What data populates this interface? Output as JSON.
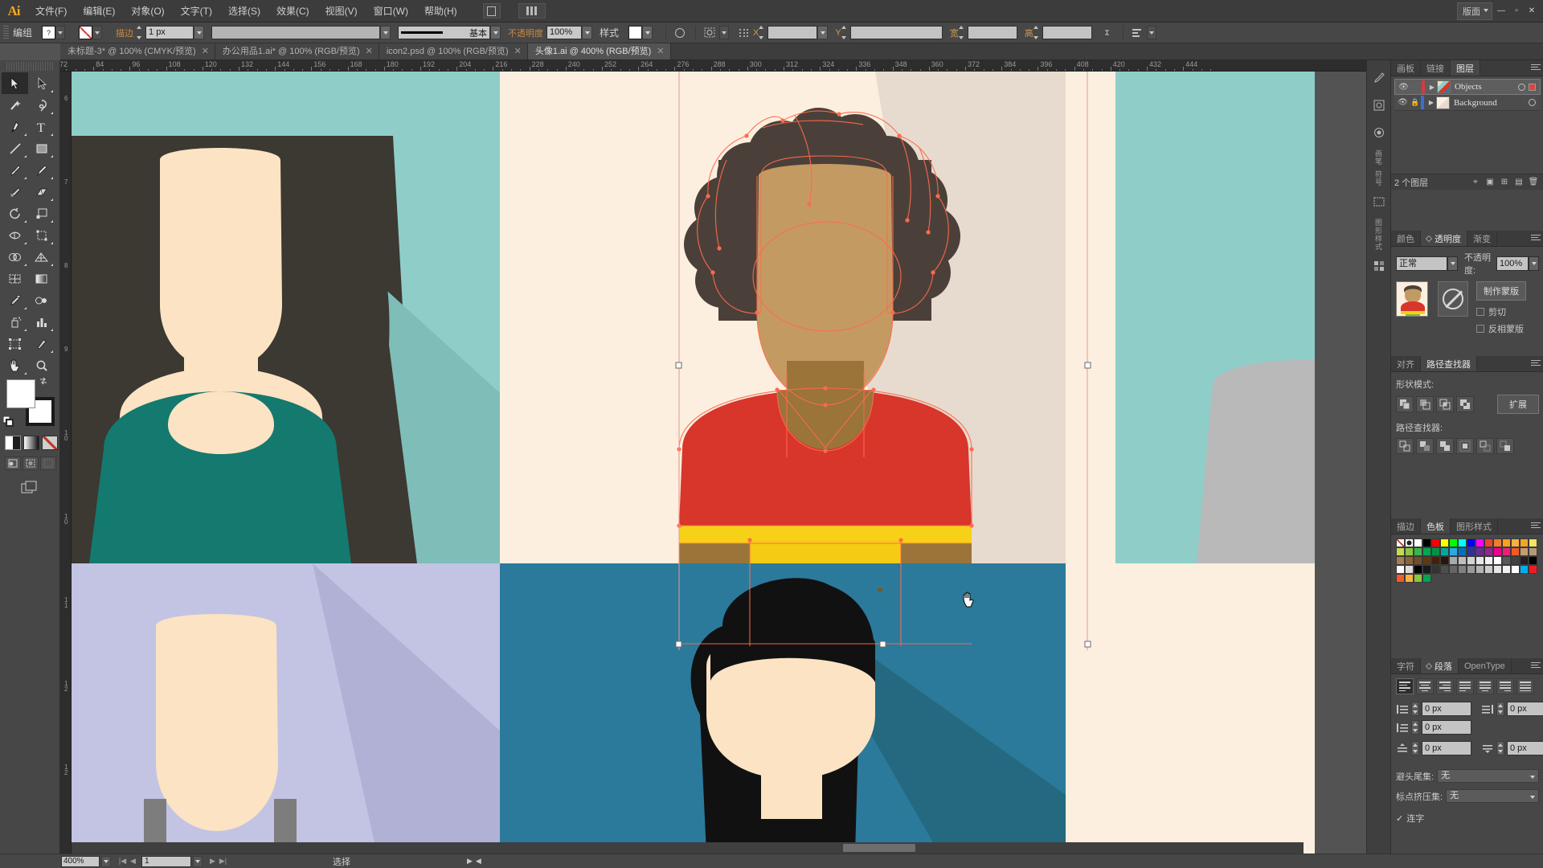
{
  "app": {
    "name": "Ai",
    "workspace_label": "版面"
  },
  "menu": {
    "items": [
      "文件(F)",
      "编辑(E)",
      "对象(O)",
      "文字(T)",
      "选择(S)",
      "效果(C)",
      "视图(V)",
      "窗口(W)",
      "帮助(H)"
    ]
  },
  "control_bar": {
    "selection_label": "编组",
    "fill_value": "?",
    "stroke_none": "none-swatch",
    "stroke_label": "描边",
    "stroke_weight": "1 px",
    "profile_value": "",
    "brush_label": "基本",
    "opacity_label": "不透明度",
    "opacity_value": "100%",
    "style_label": "样式",
    "transform_x": "",
    "transform_y": "",
    "width_label": "宽",
    "width_value": "",
    "height_label": "高",
    "height_value": "",
    "angle_value": ""
  },
  "tabs": [
    {
      "label": "未标题-3* @ 100% (CMYK/预览)",
      "active": false
    },
    {
      "label": "办公用品1.ai* @ 100% (RGB/预览)",
      "active": false
    },
    {
      "label": "icon2.psd @ 100% (RGB/预览)",
      "active": false
    },
    {
      "label": "头像1.ai @ 400% (RGB/预览)",
      "active": true
    }
  ],
  "rulers": {
    "horizontal_ticks": [
      "72",
      "84",
      "96",
      "108",
      "120",
      "132",
      "144",
      "156",
      "168",
      "180",
      "192",
      "204",
      "216",
      "228",
      "240",
      "252",
      "264",
      "276",
      "288",
      "300",
      "312",
      "324",
      "336",
      "348",
      "360",
      "372",
      "384",
      "396",
      "408",
      "420",
      "432",
      "444"
    ],
    "vertical_ticks": [
      "6",
      "7",
      "8",
      "9",
      "10",
      "10",
      "11",
      "12",
      "12"
    ],
    "unit": "px"
  },
  "toolbar": {
    "tools": [
      "selection-tool",
      "direct-selection-tool",
      "magic-wand-tool",
      "lasso-tool",
      "pen-tool",
      "type-tool",
      "line-segment-tool",
      "rectangle-tool",
      "paintbrush-tool",
      "pencil-tool",
      "blob-brush-tool",
      "eraser-tool",
      "rotate-tool",
      "scale-tool",
      "width-tool",
      "free-transform-tool",
      "shape-builder-tool",
      "perspective-grid-tool",
      "mesh-tool",
      "gradient-tool",
      "eyedropper-tool",
      "blend-tool",
      "symbol-sprayer-tool",
      "column-graph-tool",
      "artboard-tool",
      "slice-tool",
      "hand-tool",
      "zoom-tool"
    ],
    "fill_color": "#ffffff",
    "stroke_color": "#ffffff",
    "modes": [
      "color-mode",
      "gradient-mode",
      "none-mode"
    ],
    "screen_modes": [
      "normal-screen-mode",
      "full-screen-menu-mode",
      "full-screen-mode"
    ]
  },
  "dock": {
    "rail_labels": [
      "画笔",
      "符号",
      "图形样式",
      "画板",
      "色板"
    ],
    "layers_panel": {
      "tabs": [
        "画板",
        "链接",
        "图层"
      ],
      "active_tab": "图层",
      "rows": [
        {
          "name": "Objects",
          "visible": true,
          "locked": false,
          "selected": true,
          "color": "#cf3e3e"
        },
        {
          "name": "Background",
          "visible": true,
          "locked": true,
          "selected": false,
          "color": "#3e6fcf"
        }
      ],
      "footer_count": "2 个图层"
    },
    "transparency_panel": {
      "tabs": [
        "颜色",
        "透明度",
        "渐变"
      ],
      "active_tab": "透明度",
      "blend_mode": "正常",
      "opacity_label": "不透明度:",
      "opacity_value": "100%",
      "make_mask_button": "制作蒙版",
      "clip_label": "剪切",
      "invert_mask_label": "反相蒙版"
    },
    "pathfinder_panel": {
      "tabs": [
        "对齐",
        "路径查找器"
      ],
      "active_tab": "路径查找器",
      "shape_modes_label": "形状模式:",
      "expand_button": "扩展",
      "pathfinders_label": "路径查找器:"
    },
    "swatches_panel": {
      "tabs": [
        "描边",
        "色板",
        "图形样式"
      ],
      "active_tab": "色板",
      "row1": [
        "#ffffff",
        "#000000",
        "#ff0000",
        "#ffff00",
        "#00ff00",
        "#00ffff",
        "#0000ff",
        "#ff00ff",
        "#e8452c",
        "#ef7d2e",
        "#f9a01b",
        "#fbb040"
      ],
      "row2": [
        "#f5a623",
        "#f7e463",
        "#c7d94d",
        "#8dc63f",
        "#39b54a",
        "#00a651",
        "#009245",
        "#00a99d",
        "#29abe2",
        "#0071bc",
        "#2e3192",
        "#662d91"
      ],
      "row3": [
        "#92278f",
        "#ec008c",
        "#ed1e79",
        "#f15a24",
        "#c69c6d",
        "#b3987a",
        "#a67c52",
        "#8c6239",
        "#754c24",
        "#603813",
        "#42210b",
        "#2b1508"
      ],
      "row4": [
        "#a7a9ac",
        "#bcbec0",
        "#d1d3d4",
        "#e6e7e8",
        "#f1f2f2",
        "#ffffff",
        "#58595b",
        "#414042",
        "#231f20",
        "#000000",
        "#ffffff",
        "#dcdcdc"
      ],
      "row5": [
        "#000000",
        "#1a1a1a",
        "#333333",
        "#4d4d4d",
        "#666666",
        "#808080",
        "#999999",
        "#b3b3b3",
        "#cccccc",
        "#e6e6e6",
        "#f2f2f2",
        "#ffffff"
      ],
      "row6": [
        "#00aeef",
        "#ec1c24",
        "#f15a29",
        "#fbb040",
        "#8dc63f",
        "#00a651"
      ]
    },
    "paragraph_panel": {
      "tabs": [
        "字符",
        "段落",
        "OpenType"
      ],
      "active_tab": "段落",
      "indent_left": "0 px",
      "indent_right": "0 px",
      "indent_first": "0 px",
      "space_before": "0 px",
      "space_after": "0 px",
      "hanging_label": "避头尾集:",
      "hanging_value": "无",
      "burasagari_label": "标点挤压集:",
      "burasagari_value": "无",
      "hyphenate_label": "连字",
      "hyphenate_checked": true,
      "unit": "px"
    }
  },
  "status_bar": {
    "zoom": "400%",
    "page": "1",
    "status_text": "选择"
  },
  "artwork": {
    "canvas_zoom": "400%",
    "description": "flat-illustration-avatar-grid",
    "cells": [
      {
        "name": "avatar-woman-teal",
        "bg": "#8fcdc8",
        "skin": "#fbe3c3",
        "hair": "#3f3a35",
        "shirt": "#14796e"
      },
      {
        "name": "avatar-selected-afro",
        "bg": "#fcefdf",
        "skin": "#c49a63",
        "hair": "#4b4039",
        "shirt": "#d8352b",
        "stripe_yellow": "#f7d117",
        "stripe_green": "#7dbb2f",
        "arm": "#9a7439"
      },
      {
        "name": "avatar-right-teal",
        "bg": "#8fcdc8",
        "skin": "#bfbfbf"
      },
      {
        "name": "avatar-lavender",
        "bg": "#c3c3e4",
        "skin": "#fbe3c3"
      },
      {
        "name": "avatar-blue-pigtails",
        "bg": "#2b7a9b",
        "skin": "#fbe3c3",
        "hair": "#111111"
      },
      {
        "name": "avatar-cream",
        "bg": "#fcefdf"
      }
    ],
    "selection_color": "#ff6a4d",
    "cursor": "hand-cursor"
  }
}
